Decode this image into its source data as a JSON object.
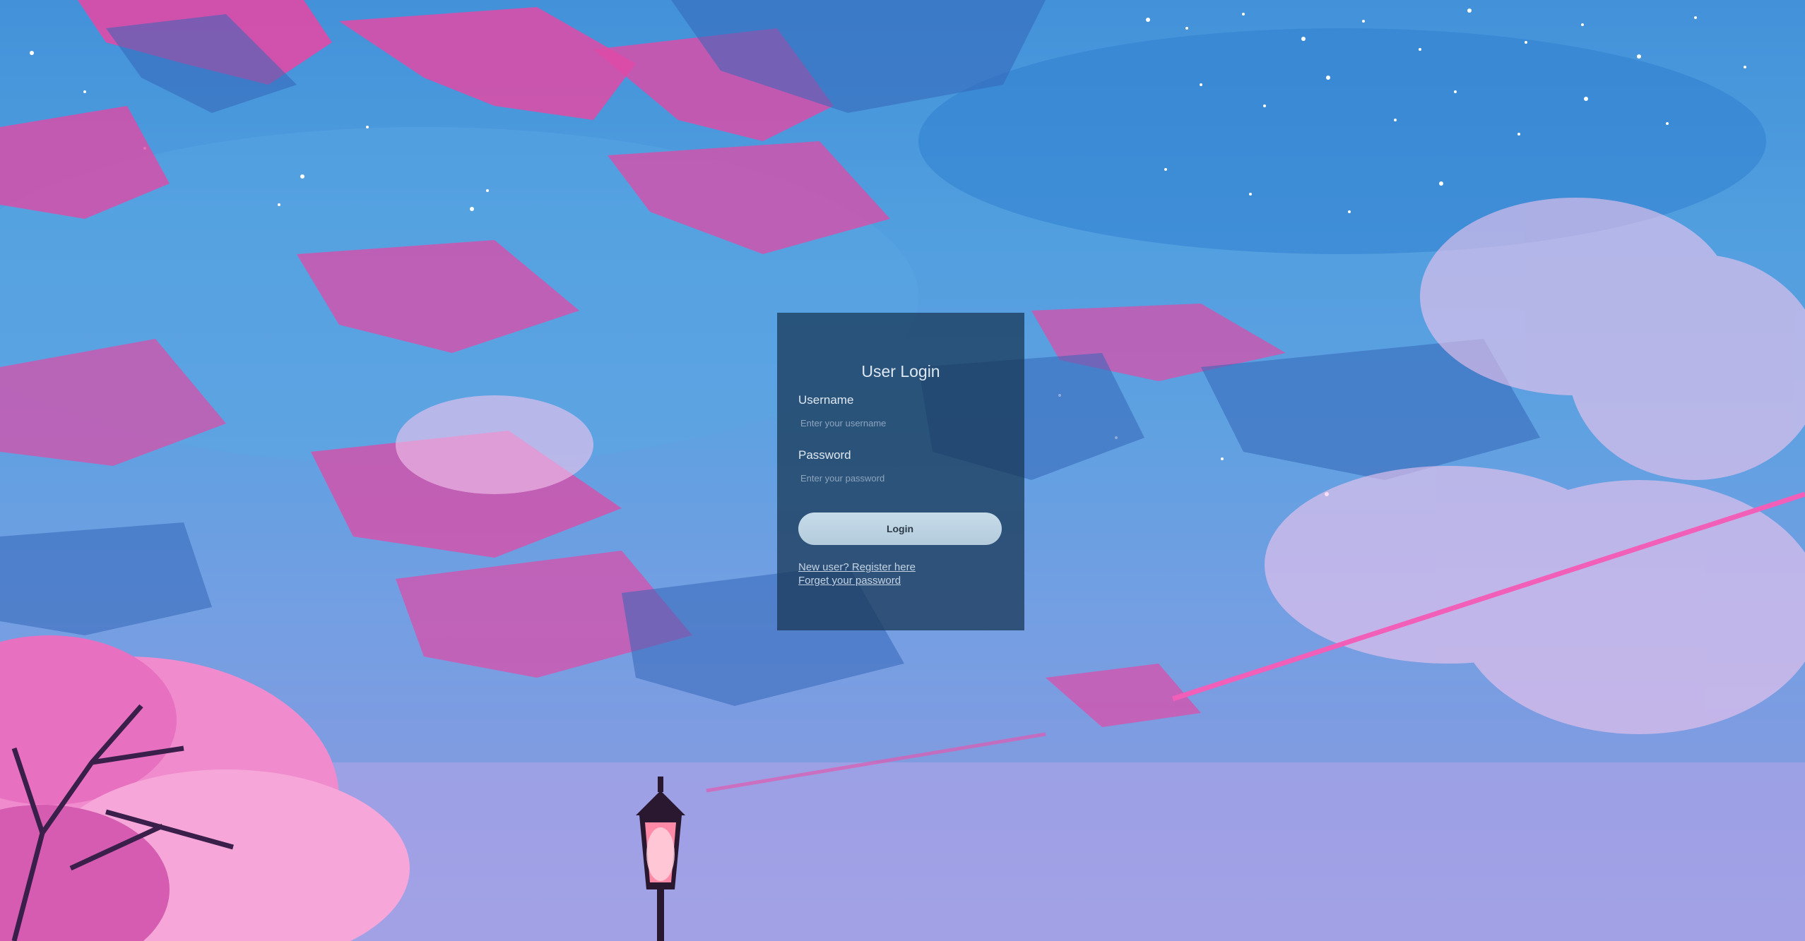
{
  "login": {
    "title": "User Login",
    "username_label": "Username",
    "username_placeholder": "Enter your username",
    "username_value": "",
    "password_label": "Password",
    "password_placeholder": "Enter your password",
    "password_value": "",
    "button_label": "Login",
    "register_link": "New user? Register here",
    "forgot_link": "Forget your password"
  },
  "colors": {
    "panel": "#163452",
    "button": "#c2d7e6",
    "sky_top": "#3f8fd8",
    "cloud_pink": "#e04aa6",
    "blossom": "#f08ccd"
  }
}
